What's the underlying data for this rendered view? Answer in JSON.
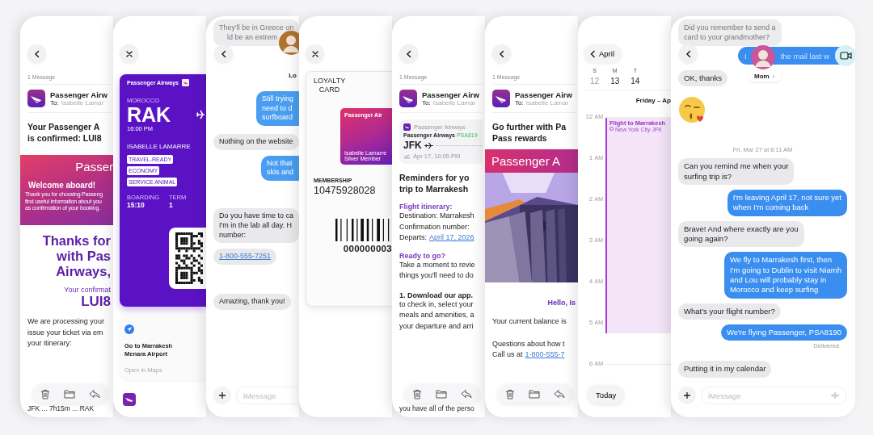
{
  "panels": [
    {
      "kind": "mail",
      "nav": {
        "kind": "back"
      },
      "count": "1 Message",
      "sender": {
        "name": "Passenger Airw",
        "to_label": "To:",
        "to": "Isabelle Lamar"
      },
      "blocks": [
        {
          "kind": "title",
          "lines": [
            "Your Passenger A",
            "is confirmed: LUI8"
          ]
        },
        {
          "kind": "banner",
          "title": "Passer",
          "heading": "Welcome aboard!",
          "lines": [
            "Thank you for choosing Passeng",
            "find useful information about you",
            "as confirmation of your booking."
          ]
        },
        {
          "kind": "big",
          "lines": [
            "Thanks for",
            "with Pas",
            "Airways,"
          ]
        },
        {
          "kind": "sub",
          "lines": [
            "Your confirmat"
          ]
        },
        {
          "kind": "code",
          "lines": [
            "LUI8"
          ]
        },
        {
          "kind": "para",
          "lines": [
            "We are processing your",
            "issue your ticket via em",
            "your itinerary:"
          ]
        }
      ],
      "footer": "JFK ... 7h15m ... RAK"
    },
    {
      "kind": "pass",
      "nav": {
        "kind": "close"
      },
      "brand": "Passenger Airways",
      "country": "MOROCCO",
      "code": "RAK",
      "time": "16:00 PM",
      "name": "ISABELLE LAMARRE",
      "tags": [
        "TRAVEL-READY",
        "ECONOMY",
        "SERVICE ANIMAL"
      ],
      "fields": [
        {
          "label": "BOARDING",
          "value": "15:10"
        },
        {
          "label": "TERM",
          "value": "1"
        }
      ],
      "maps": {
        "title_lines": [
          "Go to Marrakesh",
          "Menara Airport"
        ],
        "action": "Open in Maps"
      }
    },
    {
      "kind": "chat",
      "nav": {
        "kind": "back"
      },
      "top": {
        "lines": [
          "They'll be in Greece on",
          "ld be an extrem"
        ]
      },
      "contact": {
        "name": "Lo"
      },
      "items": [
        {
          "kind": "sent",
          "lines": [
            "Still trying",
            "need to d",
            "surfboard"
          ]
        },
        {
          "kind": "received",
          "lines": [
            "Nothing on the website"
          ]
        },
        {
          "kind": "sent",
          "lines": [
            "Not that",
            "skis and"
          ]
        },
        {
          "kind": "received",
          "lines": [
            "Do you have time to ca",
            "I'm in the lab all day. H",
            "number:"
          ]
        },
        {
          "kind": "link",
          "lines": [
            "1-800-555-7251"
          ]
        },
        {
          "kind": "received",
          "lines": [
            "Amazing, thank you!"
          ]
        }
      ],
      "placeholder": "iMessage"
    },
    {
      "kind": "loyalty",
      "nav": {
        "kind": "close"
      },
      "title_lines": [
        "LOYALTY",
        "CARD"
      ],
      "card": {
        "brand": "Passenger Air",
        "holder": "Isabelle Lamarre",
        "tier": "Silver Member"
      },
      "membership_label": "MEMBERSHIP",
      "membership": "10475928028",
      "barcode_number": "000000003"
    },
    {
      "kind": "mail",
      "nav": {
        "kind": "back"
      },
      "count": "1 Message",
      "sender": {
        "name": "Passenger Airw",
        "to_label": "To:",
        "to": "Isabelle Lamar"
      },
      "blocks": [
        {
          "kind": "flight",
          "app": "Passenger Airways",
          "airline": "Passenger Airways",
          "flight": "PSA819",
          "from": "JFK",
          "date": "Apr 17, 10:05 PM"
        },
        {
          "kind": "title",
          "lines": [
            "Reminders for yo",
            "trip to Marrakesh"
          ]
        },
        {
          "kind": "label",
          "lines": [
            "Flight itinerary:"
          ]
        },
        {
          "kind": "para",
          "lines": [
            "Destination: Marrakesh",
            "Confirmation number:"
          ]
        },
        {
          "kind": "link",
          "text": "Departs:",
          "link": "April 17, 2026"
        },
        {
          "kind": "label",
          "lines": [
            "Ready to go?"
          ]
        },
        {
          "kind": "para",
          "lines": [
            "Take a moment to revie",
            "things you'll need to do"
          ]
        },
        {
          "kind": "strong",
          "lines": [
            "1. Download our app."
          ]
        },
        {
          "kind": "para",
          "lines": [
            "to check in, select your",
            "meals and amenities, a",
            "your departure and arri"
          ]
        }
      ],
      "footer": "you have all of the perso"
    },
    {
      "kind": "mail",
      "nav": {
        "kind": "back"
      },
      "count": "1 Message",
      "sender": {
        "name": "Passenger Airw",
        "to_label": "To:",
        "to": "Isabelle Lamar"
      },
      "blocks": [
        {
          "kind": "title",
          "lines": [
            "Go further with Pa",
            "Pass rewards"
          ]
        },
        {
          "title": "Passenger A"
        },
        {
          "kind": "hello",
          "lines": [
            "Hello, Is"
          ]
        },
        {
          "kind": "para",
          "lines": [
            "Your current balance is"
          ]
        },
        {
          "kind": "para",
          "lines": [
            "Questions about how t"
          ]
        },
        {
          "kind": "link",
          "text": "Call us at",
          "link": "1-800-555-7"
        }
      ]
    },
    {
      "kind": "calendar",
      "nav_label": "April",
      "weekdays": [
        "S",
        "M",
        "T"
      ],
      "dates": [
        {
          "text": "12",
          "muted": true
        },
        {
          "text": "13",
          "muted": false
        },
        {
          "text": "14",
          "muted": false
        }
      ],
      "day_title": "Friday – Ap",
      "hours": [
        {
          "hour": "12",
          "suffix": "AM"
        },
        {
          "hour": "1",
          "suffix": "AM"
        },
        {
          "hour": "2",
          "suffix": "AM"
        },
        {
          "hour": "3",
          "suffix": "AM"
        },
        {
          "hour": "4",
          "suffix": "AM"
        },
        {
          "hour": "5",
          "suffix": "AM"
        },
        {
          "hour": "6",
          "suffix": "AM"
        }
      ],
      "event": {
        "title": "Flight to Marrakesh",
        "location": "New York City JFK"
      },
      "today": "Today"
    },
    {
      "kind": "chat",
      "nav": {
        "kind": "back"
      },
      "top": {
        "lines": [
          "Did you remember to send a",
          "card to your grandmother?"
        ]
      },
      "header_bubble": {
        "left": "I",
        "right": "the mail last w"
      },
      "contact": {
        "name": "Mom"
      },
      "items": [
        {
          "kind": "received",
          "lines": [
            "OK, thanks"
          ]
        },
        {
          "kind": "emoji"
        },
        {
          "kind": "time",
          "text": "Fri, Mar 27 at 8:11 AM"
        },
        {
          "kind": "received",
          "lines": [
            "Can you remind me when your",
            "surfing trip is?"
          ]
        },
        {
          "kind": "sent",
          "lines": [
            "I'm leaving April 17, not sure yet",
            "when I'm coming back"
          ]
        },
        {
          "kind": "received",
          "lines": [
            "Brave! And where exactly are you",
            "going again?"
          ]
        },
        {
          "kind": "sent",
          "lines": [
            "We fly to Marrakesh first, then",
            "I'm going to Dublin to visit Niamh",
            "and Lou will probably stay in",
            "Morocco and keep surfing"
          ]
        },
        {
          "kind": "received",
          "lines": [
            "What's your flight number?"
          ]
        },
        {
          "kind": "sent",
          "lines": [
            "We're flying Passenger, PSA8190"
          ]
        },
        {
          "kind": "status",
          "text": "Delivered"
        },
        {
          "kind": "received",
          "lines": [
            "Putting it in my calendar"
          ]
        }
      ],
      "placeholder": "iMessage"
    }
  ]
}
